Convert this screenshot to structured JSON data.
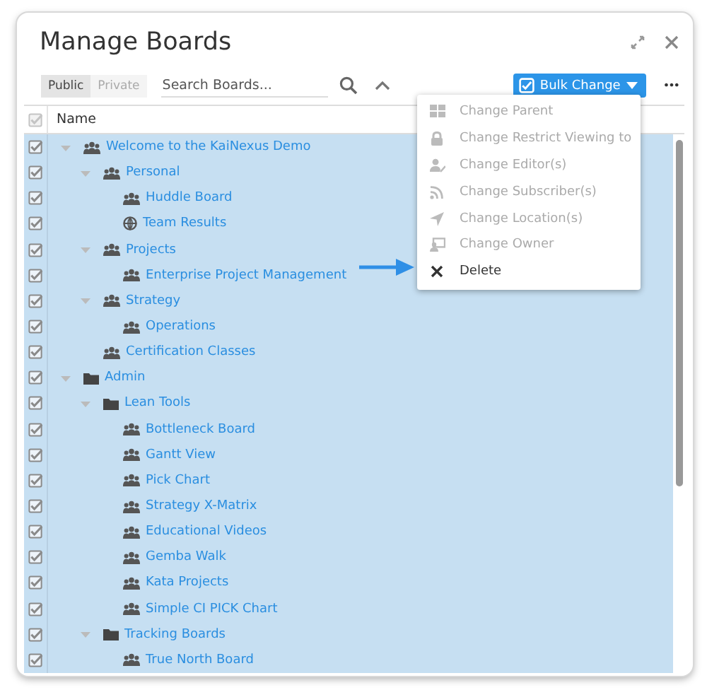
{
  "dialog": {
    "title": "Manage Boards"
  },
  "toolbar": {
    "segments": [
      {
        "label": "Public",
        "selected": true
      },
      {
        "label": "Private",
        "selected": false
      }
    ],
    "search": {
      "placeholder": "Search Boards..."
    },
    "bulk_button": {
      "label": "Bulk Change"
    },
    "more": {
      "label": "•••"
    }
  },
  "table": {
    "columns": [
      {
        "label": "Name"
      }
    ],
    "select_all": {
      "checked": true
    },
    "rows": [
      {
        "label": "Welcome to the KaiNexus Demo",
        "kind": "group",
        "checked": true,
        "expanded": true,
        "children": [
          {
            "label": "Personal",
            "kind": "group",
            "checked": true,
            "expanded": true,
            "children": [
              {
                "label": "Huddle Board",
                "kind": "group",
                "checked": true
              },
              {
                "label": "Team Results",
                "kind": "globe",
                "checked": true
              }
            ]
          },
          {
            "label": "Projects",
            "kind": "group",
            "checked": true,
            "expanded": true,
            "children": [
              {
                "label": "Enterprise Project Management",
                "kind": "group",
                "checked": true
              }
            ]
          },
          {
            "label": "Strategy",
            "kind": "group",
            "checked": true,
            "expanded": true,
            "children": [
              {
                "label": "Operations",
                "kind": "group",
                "checked": true
              }
            ]
          },
          {
            "label": "Certification Classes",
            "kind": "group",
            "checked": true
          }
        ]
      },
      {
        "label": "Admin",
        "kind": "folder",
        "checked": true,
        "expanded": true,
        "children": [
          {
            "label": "Lean Tools",
            "kind": "folder",
            "checked": true,
            "expanded": true,
            "children": [
              {
                "label": "Bottleneck Board",
                "kind": "group",
                "checked": true
              },
              {
                "label": "Gantt View",
                "kind": "group",
                "checked": true
              },
              {
                "label": "Pick Chart",
                "kind": "group",
                "checked": true
              },
              {
                "label": "Strategy X-Matrix",
                "kind": "group",
                "checked": true
              },
              {
                "label": "Educational Videos",
                "kind": "group",
                "checked": true
              },
              {
                "label": "Gemba Walk",
                "kind": "group",
                "checked": true
              },
              {
                "label": "Kata Projects",
                "kind": "group",
                "checked": true
              },
              {
                "label": "Simple CI PICK Chart",
                "kind": "group",
                "checked": true
              }
            ]
          },
          {
            "label": "Tracking Boards",
            "kind": "folder",
            "checked": true,
            "expanded": true,
            "children": [
              {
                "label": "True North Board",
                "kind": "group",
                "checked": true
              }
            ]
          }
        ]
      }
    ]
  },
  "bulk_menu": {
    "items": [
      {
        "label": "Change Parent",
        "kind": "grid",
        "disabled": true
      },
      {
        "label": "Change Restrict Viewing to",
        "kind": "lock",
        "disabled": true
      },
      {
        "label": "Change Editor(s)",
        "kind": "user",
        "disabled": true
      },
      {
        "label": "Change Subscriber(s)",
        "kind": "feed",
        "disabled": true
      },
      {
        "label": "Change Location(s)",
        "kind": "arrow",
        "disabled": true
      },
      {
        "label": "Change Owner",
        "kind": "owner",
        "disabled": true
      },
      {
        "label": "Delete",
        "kind": "delete",
        "disabled": false
      }
    ]
  }
}
